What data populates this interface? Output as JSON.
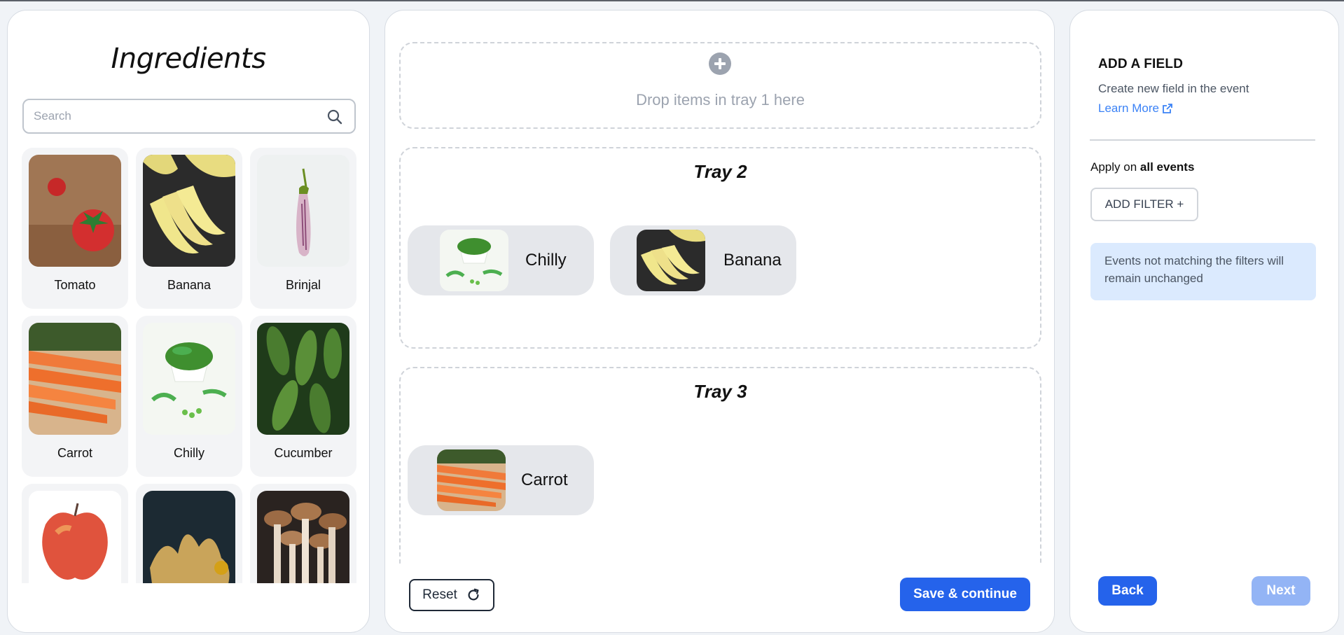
{
  "ingredients_panel": {
    "title": "Ingredients",
    "search": {
      "placeholder": "Search",
      "value": ""
    },
    "items": [
      {
        "label": "Tomato"
      },
      {
        "label": "Banana"
      },
      {
        "label": "Brinjal"
      },
      {
        "label": "Carrot"
      },
      {
        "label": "Chilly"
      },
      {
        "label": "Cucumber"
      },
      {
        "label": ""
      },
      {
        "label": ""
      },
      {
        "label": ""
      }
    ]
  },
  "trays": {
    "tray1": {
      "drop_text": "Drop items in tray 1 here"
    },
    "tray2": {
      "title": "Tray 2",
      "items": [
        {
          "label": "Chilly"
        },
        {
          "label": "Banana"
        }
      ]
    },
    "tray3": {
      "title": "Tray 3",
      "items": [
        {
          "label": "Carrot"
        }
      ]
    }
  },
  "actions": {
    "reset_label": "Reset",
    "save_label": "Save & continue"
  },
  "field_panel": {
    "title": "ADD A FIELD",
    "description": "Create new field in the event",
    "learn_more": "Learn More",
    "apply_prefix": "Apply on",
    "apply_target": "all events",
    "add_filter_label": "ADD FILTER +",
    "info": "Events not matching the filters will remain unchanged",
    "back_label": "Back",
    "next_label": "Next"
  },
  "colors": {
    "primary": "#2563eb",
    "primary_disabled": "#93b4f5",
    "info_bg": "#dbeafe",
    "card_bg": "#f3f4f6",
    "pill_bg": "#e5e7eb"
  }
}
